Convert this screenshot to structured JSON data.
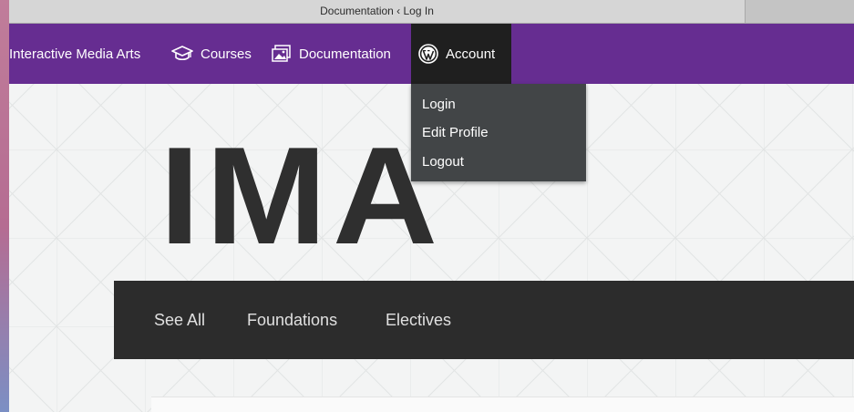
{
  "browser": {
    "tab_title": "Documentation ‹ Log In"
  },
  "admin_bar": {
    "site_name": "Interactive Media Arts",
    "courses_label": "Courses",
    "documentation_label": "Documentation",
    "account_label": "Account",
    "icons": {
      "courses": "graduation-cap-icon",
      "documentation": "gallery-icon",
      "account": "wordpress-icon"
    },
    "colors": {
      "bar": "#662d91",
      "account_active": "#1f1f1f",
      "dropdown": "#424547"
    }
  },
  "account_menu": {
    "items": [
      "Login",
      "Edit Profile",
      "Logout"
    ]
  },
  "page": {
    "logo": "IMA",
    "nav": [
      "See All",
      "Foundations",
      "Electives"
    ]
  }
}
